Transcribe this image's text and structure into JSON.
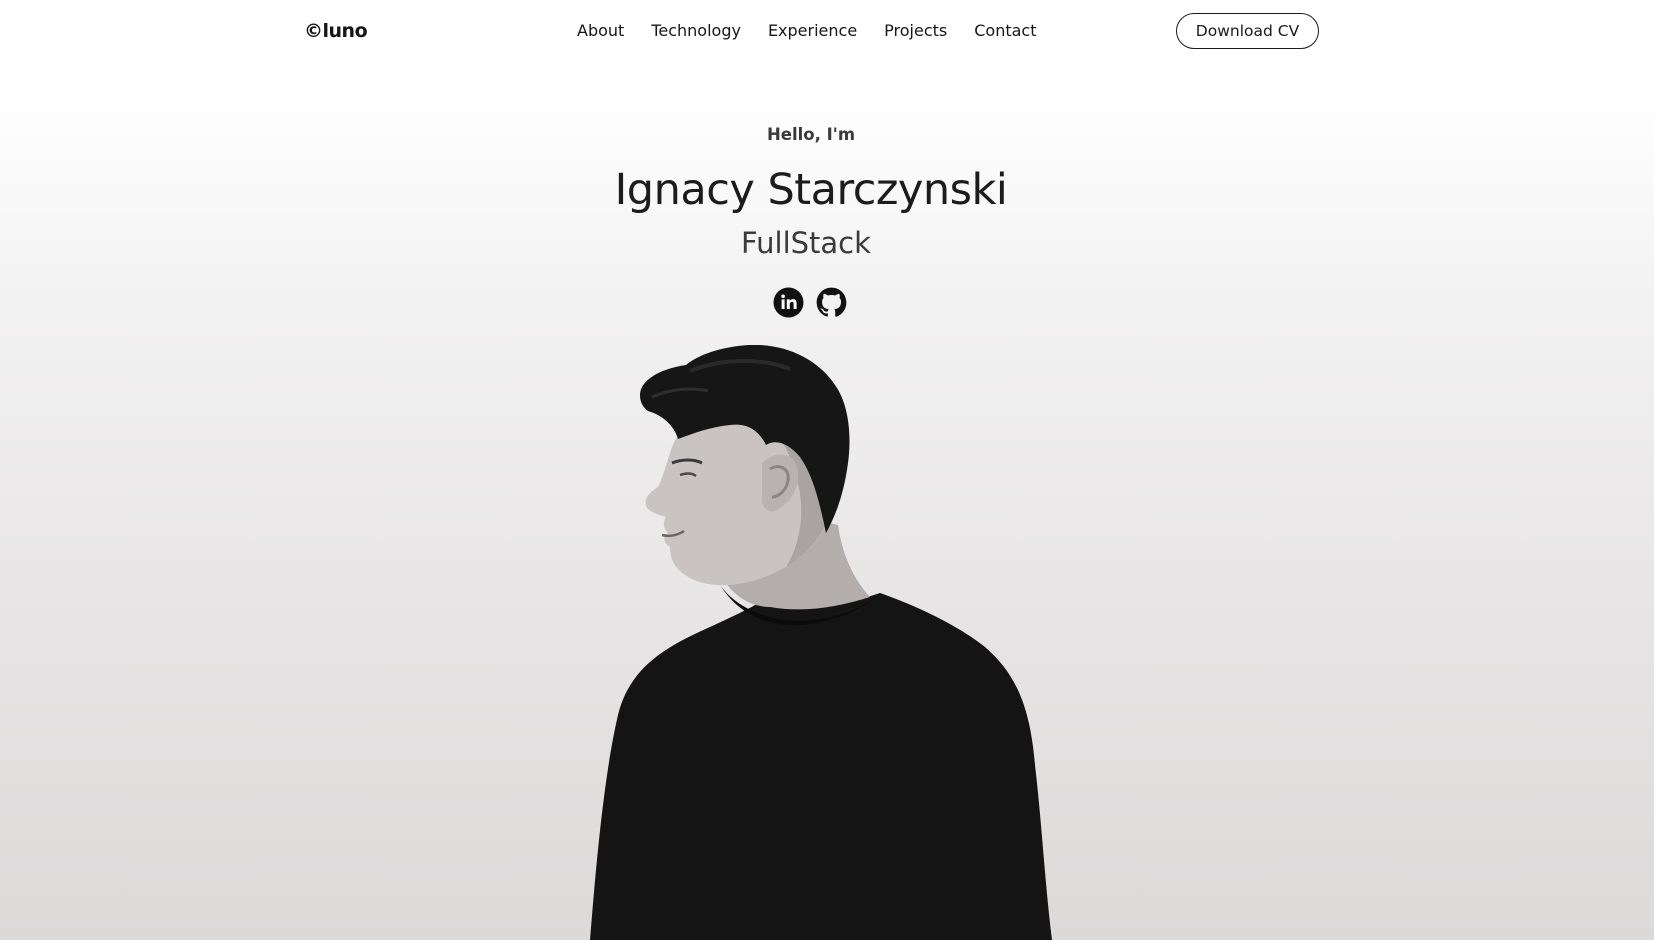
{
  "nav": {
    "logo": "©luno",
    "links": [
      "About",
      "Technology",
      "Experience",
      "Projects",
      "Contact"
    ],
    "cv_button": "Download CV"
  },
  "hero": {
    "greeting": "Hello, I'm",
    "name": "Ignacy Starczynski",
    "role": "FullStack",
    "socials": [
      {
        "icon": "linkedin-icon"
      },
      {
        "icon": "github-icon"
      }
    ]
  },
  "colors": {
    "text": "#1a1a1a",
    "background_top": "#ffffff",
    "background_bottom": "#dcd9d9",
    "shirt": "#161616"
  }
}
